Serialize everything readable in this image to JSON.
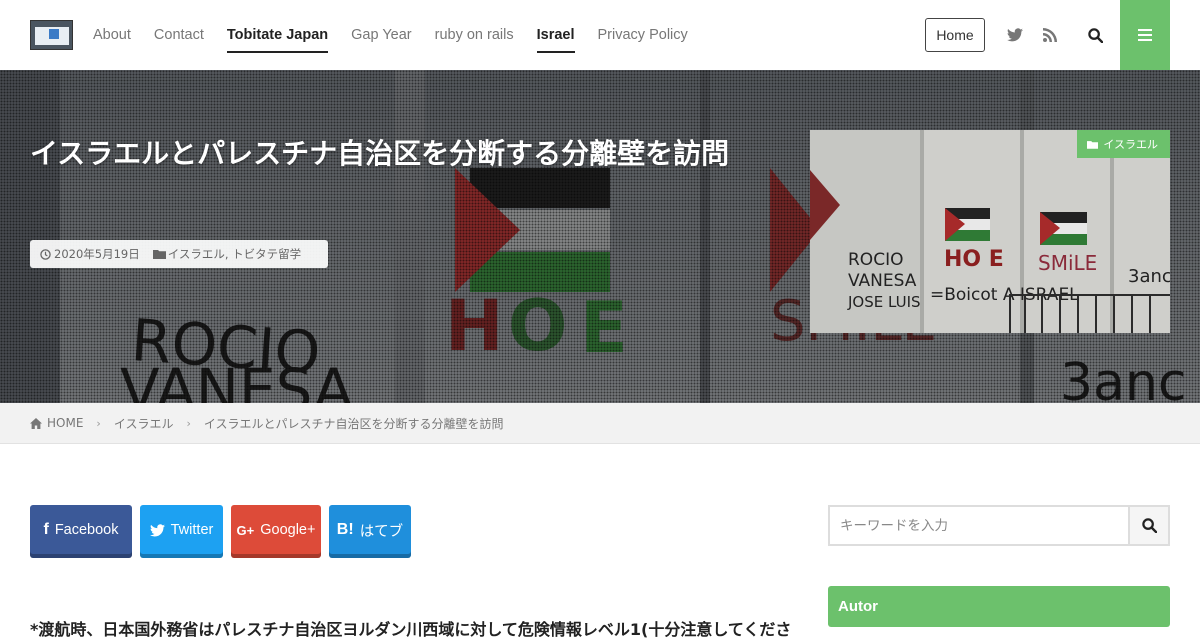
{
  "header": {
    "nav": [
      {
        "label": "About",
        "active": false
      },
      {
        "label": "Contact",
        "active": false
      },
      {
        "label": "Tobitate Japan",
        "active": true
      },
      {
        "label": "Gap Year",
        "active": false
      },
      {
        "label": "ruby on rails",
        "active": false
      },
      {
        "label": "Israel",
        "active": true
      },
      {
        "label": "Privacy Policy",
        "active": false
      }
    ],
    "home_button": "Home",
    "icons": [
      "twitter-icon",
      "rss-icon",
      "search-icon",
      "hamburger-menu-icon"
    ]
  },
  "hero": {
    "title": "イスラエルとパレスチナ自治区を分断する分離壁を訪問",
    "date": "2020年5月19日",
    "categories": "イスラエル, トビタテ留学",
    "thumbnail_category": "イスラエル",
    "graffiti": {
      "line1": "ROCIO",
      "line2": "VANESA",
      "line3": "JOSE LUIS",
      "hope": "HO E",
      "smile": "SMiLE",
      "boicot": "=Boicot A ISRAEL",
      "band": "3anc"
    }
  },
  "breadcrumb": {
    "home": "HOME",
    "category": "イスラエル",
    "current": "イスラエルとパレスチナ自治区を分断する分離壁を訪問"
  },
  "share": [
    {
      "icon": "f",
      "label": "Facebook",
      "color": "#3b5998"
    },
    {
      "icon": "🐦",
      "label": "Twitter",
      "color": "#1da1f2"
    },
    {
      "icon": "G+",
      "label": "Google+",
      "color": "#dd4b39"
    },
    {
      "icon": "B!",
      "label": "はてブ",
      "color": "#1f8fdc"
    }
  ],
  "article": {
    "lead": "*渡航時、日本国外務省はパレスチナ自治区ヨルダン川西域に対して危険情報レベル1(十分注意してくださ"
  },
  "sidebar": {
    "search_placeholder": "キーワードを入力",
    "widget_title": "Autor"
  },
  "colors": {
    "accent": "#6cc16c",
    "facebook": "#3b5998",
    "twitter": "#1da1f2",
    "googleplus": "#dd4b39",
    "hatena": "#1f8fdc"
  }
}
